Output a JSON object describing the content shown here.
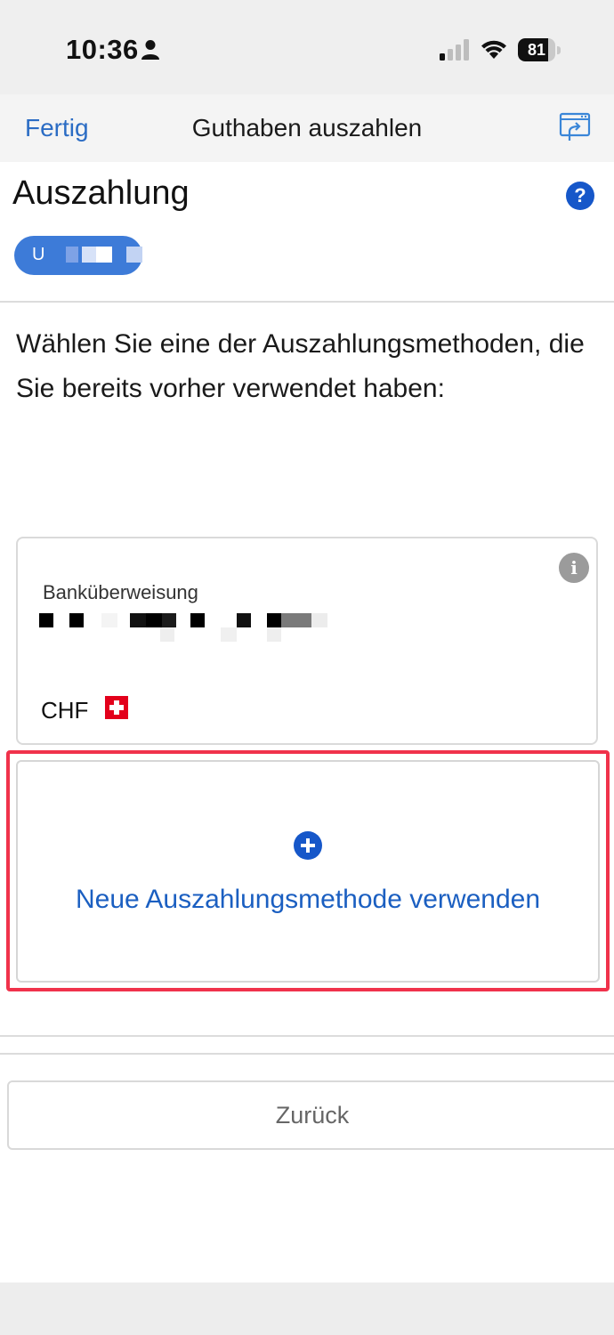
{
  "status_bar": {
    "time": "10:36",
    "battery_level": 81,
    "battery_label": "81",
    "icons": [
      "person-icon",
      "signal-icon",
      "wifi-icon",
      "battery-icon"
    ]
  },
  "nav": {
    "done_label": "Fertig",
    "title": "Guthaben auszahlen",
    "share_icon": "share-screen-icon"
  },
  "header": {
    "heading": "Auszahlung",
    "help_symbol": "?",
    "account_initial": "U"
  },
  "intro": "Wählen Sie eine der Auszahlungsmethoden, die Sie bereits vorher verwendet haben:",
  "saved_method": {
    "info_symbol": "i",
    "name": "Banküberweisung",
    "currency": "CHF",
    "flag": "swiss-flag-icon"
  },
  "new_method": {
    "label": "Neue Auszahlungsmethode verwenden",
    "highlight_color": "#f0324b"
  },
  "footer": {
    "back_label": "Zurück"
  },
  "colors": {
    "accent": "#1657c9",
    "link": "#2b6cc4"
  }
}
